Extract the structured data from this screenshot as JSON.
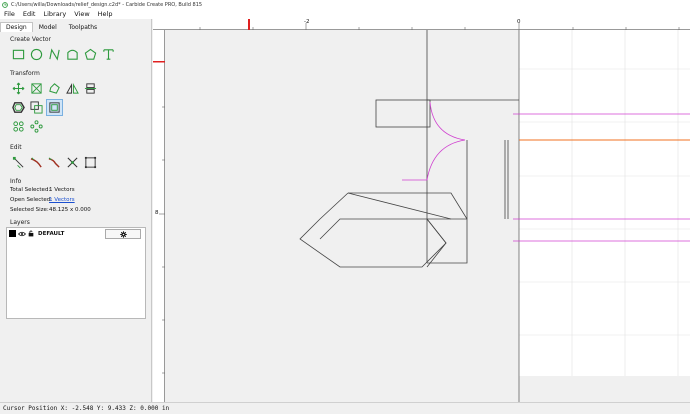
{
  "window": {
    "title": "C:/Users/willa/Downloads/relief_design.c2d* - Carbide Create PRO, Build 815"
  },
  "menu": [
    "File",
    "Edit",
    "Library",
    "View",
    "Help"
  ],
  "tabs": [
    "Design",
    "Model",
    "Toolpaths"
  ],
  "active_tab": "Design",
  "sections": {
    "create_vector": "Create Vector",
    "transform": "Transform",
    "edit": "Edit",
    "info": "Info",
    "layers": "Layers"
  },
  "tool_icons": {
    "create_vector": [
      "rectangle-icon",
      "circle-icon",
      "curve-icon",
      "polygon-icon",
      "pentagon-icon",
      "text-icon"
    ],
    "transform_row1": [
      "move-icon",
      "resize-icon",
      "rotate-icon",
      "mirror-icon",
      "align-icon"
    ],
    "transform_row2": [
      "offset-icon",
      "boolean-icon",
      "selected-group-icon"
    ],
    "transform_row3": [
      "array-icon",
      "circular-array-icon"
    ],
    "edit": [
      "node-edit-icon",
      "trim-icon",
      "fillet-icon",
      "split-icon",
      "join-icon"
    ]
  },
  "info": {
    "total_selected_label": "Total Selected:",
    "total_selected_value": "1 Vectors",
    "open_selected_label": "Open Selected:",
    "open_selected_value": "1 Vectors",
    "selected_size_label": "Selected Size:",
    "selected_size_value": "48.125 x 0.000"
  },
  "layers": [
    {
      "name": "DEFAULT",
      "color": "#000000"
    }
  ],
  "ruler": {
    "top_labels": [
      "-2",
      "0"
    ],
    "left_labels": [
      "8"
    ]
  },
  "status": {
    "text": "Cursor Position X: -2.548 Y: 9.433 Z: 0.000 in"
  },
  "colors": {
    "accent_green": "#2e9a3e",
    "selection_magenta": "#d040d0",
    "origin_orange": "#f07020",
    "ruler_marker_red": "#e02020",
    "link_blue": "#1a4fd0"
  }
}
